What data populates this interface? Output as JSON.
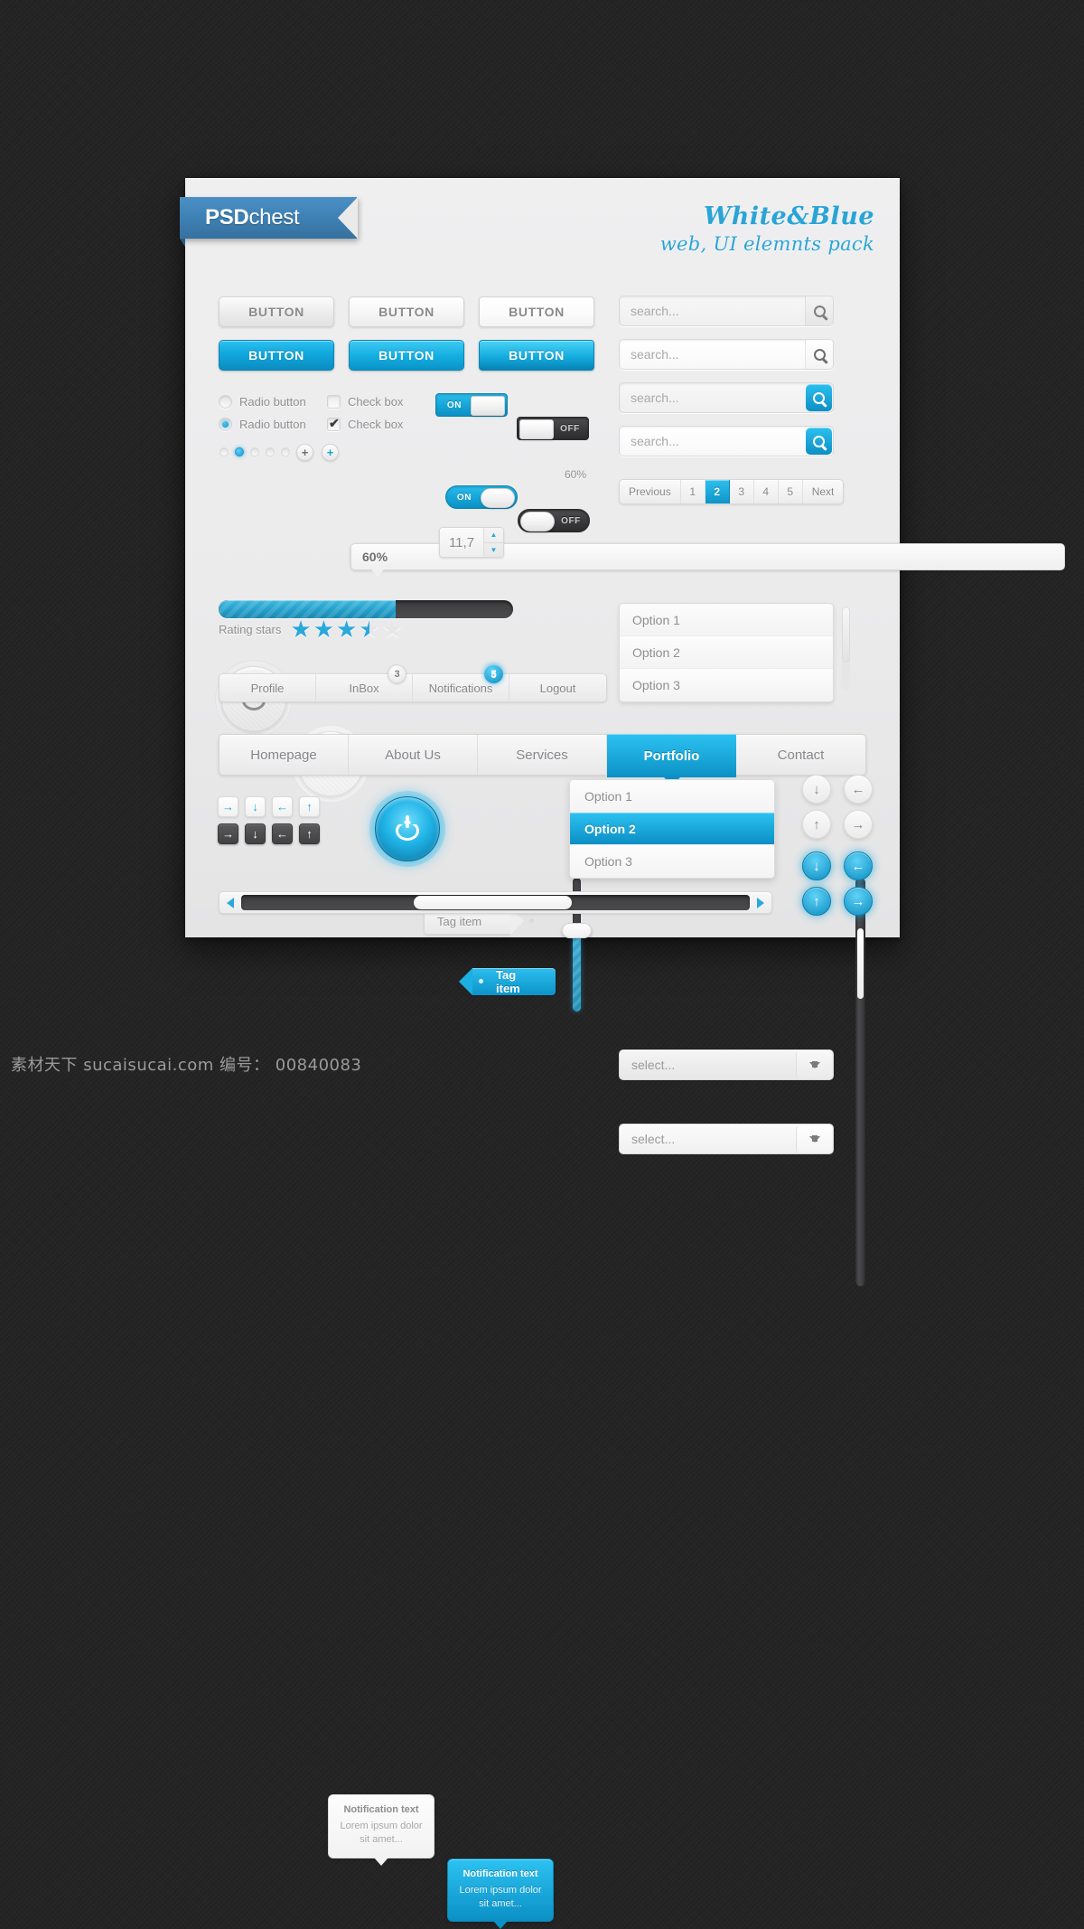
{
  "brand": {
    "ribbon_bold": "PSD",
    "ribbon_light": "chest"
  },
  "headline": {
    "line1": "White&Blue",
    "line2": "web, UI elemnts pack"
  },
  "buttons": {
    "grey": [
      "BUTTON",
      "BUTTON",
      "BUTTON"
    ],
    "blue": [
      "BUTTON",
      "BUTTON",
      "BUTTON"
    ]
  },
  "controls": {
    "radio_off_label": "Radio button",
    "radio_on_label": "Radio button",
    "checkbox_off_label": "Check box",
    "checkbox_on_label": "Check box",
    "toggle_on_label": "ON",
    "toggle_off_label": "OFF",
    "plus_symbol": "+",
    "progress_tooltip": "60%",
    "progress_percent": 60
  },
  "slider": {
    "label": "60%",
    "percent": 60
  },
  "rating": {
    "label": "Rating stars",
    "value": 3.5,
    "max": 5,
    "star_glyph": "★"
  },
  "spinner": {
    "value": "11,7",
    "up": "▲",
    "down": "▼"
  },
  "tags": {
    "grey_label": "Tag item",
    "blue_label": "Tag item"
  },
  "search": {
    "placeholder": "search...",
    "fields": [
      "search...",
      "search...",
      "search...",
      "search..."
    ]
  },
  "pagination": {
    "previous": "Previous",
    "next": "Next",
    "pages": [
      "1",
      "2",
      "3",
      "4",
      "5"
    ],
    "active": "2"
  },
  "selects": {
    "placeholder": "select...",
    "first": "select...",
    "second": "select...",
    "options": [
      "Option 1",
      "Option 2",
      "Option 3"
    ]
  },
  "account_tabs": [
    {
      "label": "Profile",
      "badge": null
    },
    {
      "label": "InBox",
      "badge": "3",
      "badge_style": "grey"
    },
    {
      "label": "Notifications",
      "badge": "5",
      "badge_style": "blue"
    },
    {
      "label": "Logout",
      "badge": null
    }
  ],
  "main_nav": {
    "items": [
      "Homepage",
      "About Us",
      "Services",
      "Portfolio",
      "Contact"
    ],
    "active": "Portfolio"
  },
  "nav_dropdown": {
    "options": [
      "Option 1",
      "Option 2",
      "Option 3"
    ],
    "active": "Option 2"
  },
  "arrow_buttons": {
    "white": [
      "→",
      "↓",
      "←",
      "↑"
    ],
    "dark": [
      "→",
      "↓",
      "←",
      "↑"
    ]
  },
  "notifications": {
    "grey": {
      "title": "Notification text",
      "body": "Lorem ipsum dolor sit amet..."
    },
    "blue": {
      "title": "Notification text",
      "body": "Lorem ipsum dolor sit amet..."
    }
  },
  "circle_arrows": {
    "grey": [
      "↓",
      "←",
      "↑",
      "→"
    ],
    "blue": [
      "↓",
      "←",
      "↑",
      "→"
    ]
  },
  "colors": {
    "accent_blue": "#19a8da",
    "accent_blue_dark": "#0b8cc0",
    "card_bg": "#ebebec",
    "page_bg": "#252525",
    "text_grey": "#8e8e90",
    "ribbon_blue": "#3f82b6"
  },
  "watermark": "素材天下  sucaisucai.com  编号： 00840083"
}
